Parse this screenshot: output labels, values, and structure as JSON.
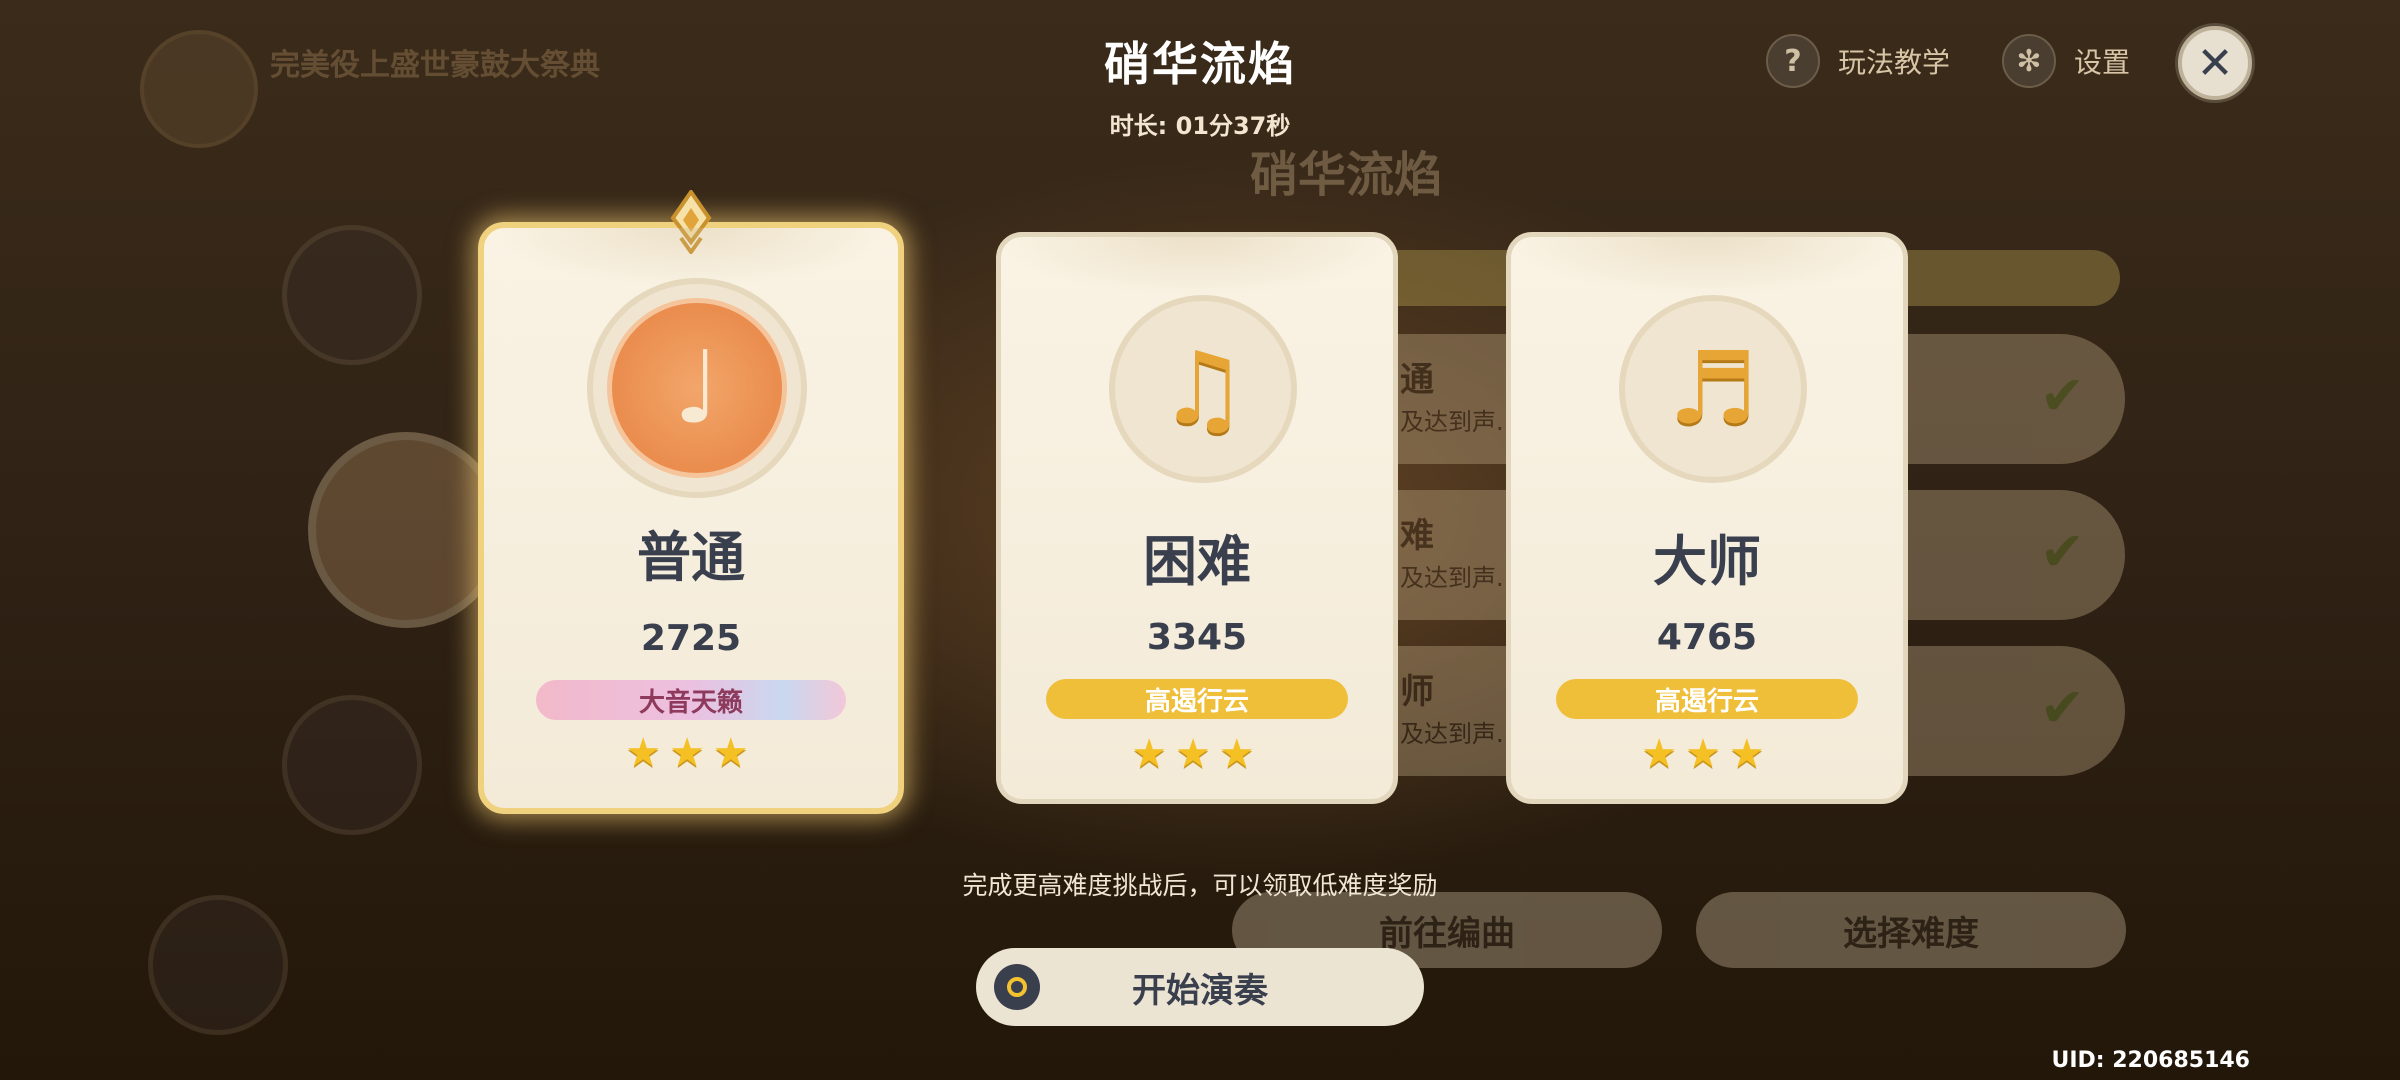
{
  "background": {
    "event_title": "完美役上盛世豪鼓大祭典",
    "panel_title": "硝华流焰",
    "rows": [
      {
        "label": "通",
        "sub": "及达到声..."
      },
      {
        "label": "难",
        "sub": "及达到声..."
      },
      {
        "label": "师",
        "sub": "及达到声..."
      }
    ],
    "arrange_button": "前往编曲",
    "select_button": "选择难度"
  },
  "header": {
    "song_title": "硝华流焰",
    "duration_label": "时长:",
    "duration_value": "01分37秒",
    "tutorial_label": "玩法教学",
    "settings_label": "设置",
    "tutorial_icon": "question-icon",
    "settings_icon": "gear-icon",
    "close_icon": "close-icon"
  },
  "cards": [
    {
      "difficulty": "普通",
      "score": "2725",
      "rank": "大音天籁",
      "stars": "★★★",
      "selected": true,
      "icon": "single-note-icon"
    },
    {
      "difficulty": "困难",
      "score": "3345",
      "rank": "高遏行云",
      "stars": "★★★",
      "selected": false,
      "icon": "double-note-icon"
    },
    {
      "difficulty": "大师",
      "score": "4765",
      "rank": "高遏行云",
      "stars": "★★★",
      "selected": false,
      "icon": "triple-note-icon"
    }
  ],
  "footer": {
    "hint": "完成更高难度挑战后，可以领取低难度奖励",
    "start_button": "开始演奏",
    "uid": "UID: 220685146"
  },
  "colors": {
    "accent_gold": "#efbf3a",
    "selected_border": "#f0d27e",
    "text_dark": "#3a3f4e",
    "star": "#f4c024"
  }
}
